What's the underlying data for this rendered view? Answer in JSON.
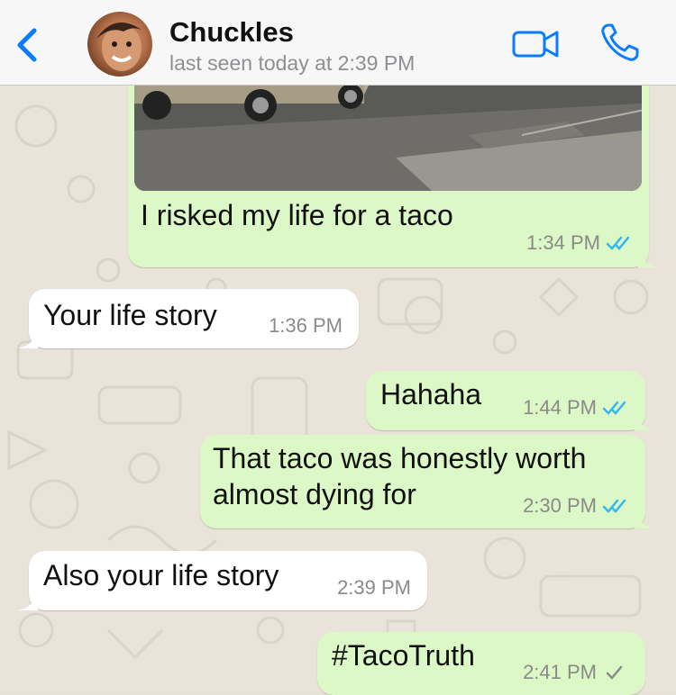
{
  "header": {
    "contact_name": "Chuckles",
    "last_seen": "last seen today at 2:39 PM"
  },
  "icons": {
    "back": "chevron-left-icon",
    "video": "video-camera-icon",
    "call": "phone-icon",
    "read_receipt": "double-check-icon",
    "delivered_receipt": "single-check-icon"
  },
  "colors": {
    "accent": "#0a7cff",
    "outgoing_bubble": "#dcf8c6",
    "incoming_bubble": "#ffffff",
    "read_tick": "#34b7f1"
  },
  "messages": [
    {
      "direction": "out",
      "text": "I risked my life for a taco",
      "time": "1:34 PM",
      "status": "read",
      "has_image": true
    },
    {
      "direction": "in",
      "text": "Your life story",
      "time": "1:36 PM"
    },
    {
      "direction": "out",
      "text": "Hahaha",
      "time": "1:44 PM",
      "status": "read"
    },
    {
      "direction": "out",
      "text_line1": "That taco was honestly worth",
      "text_line2": "almost dying for",
      "time": "2:30 PM",
      "status": "read"
    },
    {
      "direction": "in",
      "text": "Also your life story",
      "time": "2:39 PM"
    },
    {
      "direction": "out",
      "text": "#TacoTruth",
      "time": "2:41 PM",
      "status": "sent"
    }
  ]
}
